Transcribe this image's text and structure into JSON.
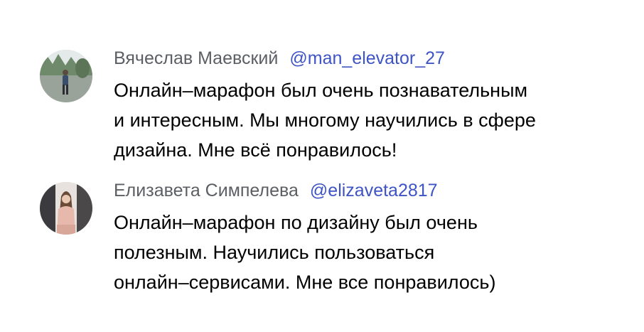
{
  "comments": [
    {
      "author": "Вячеслав Маевский",
      "handle": "@man_elevator_27",
      "lines": [
        "Онлайн–марафон был очень познавательным",
        "и интересным. Мы многому научились в сфере",
        "дизайна. Мне всё понравилось!"
      ]
    },
    {
      "author": "Елизавета Симпелева",
      "handle": "@elizaveta2817",
      "lines": [
        "Онлайн–марафон по дизайну был очень",
        "полезным. Научились пользоваться",
        "онлайн–сервисами. Мне все понравилось)"
      ]
    }
  ],
  "colors": {
    "author": "#5b5f63",
    "handle": "#3e54c5",
    "text": "#000000"
  }
}
